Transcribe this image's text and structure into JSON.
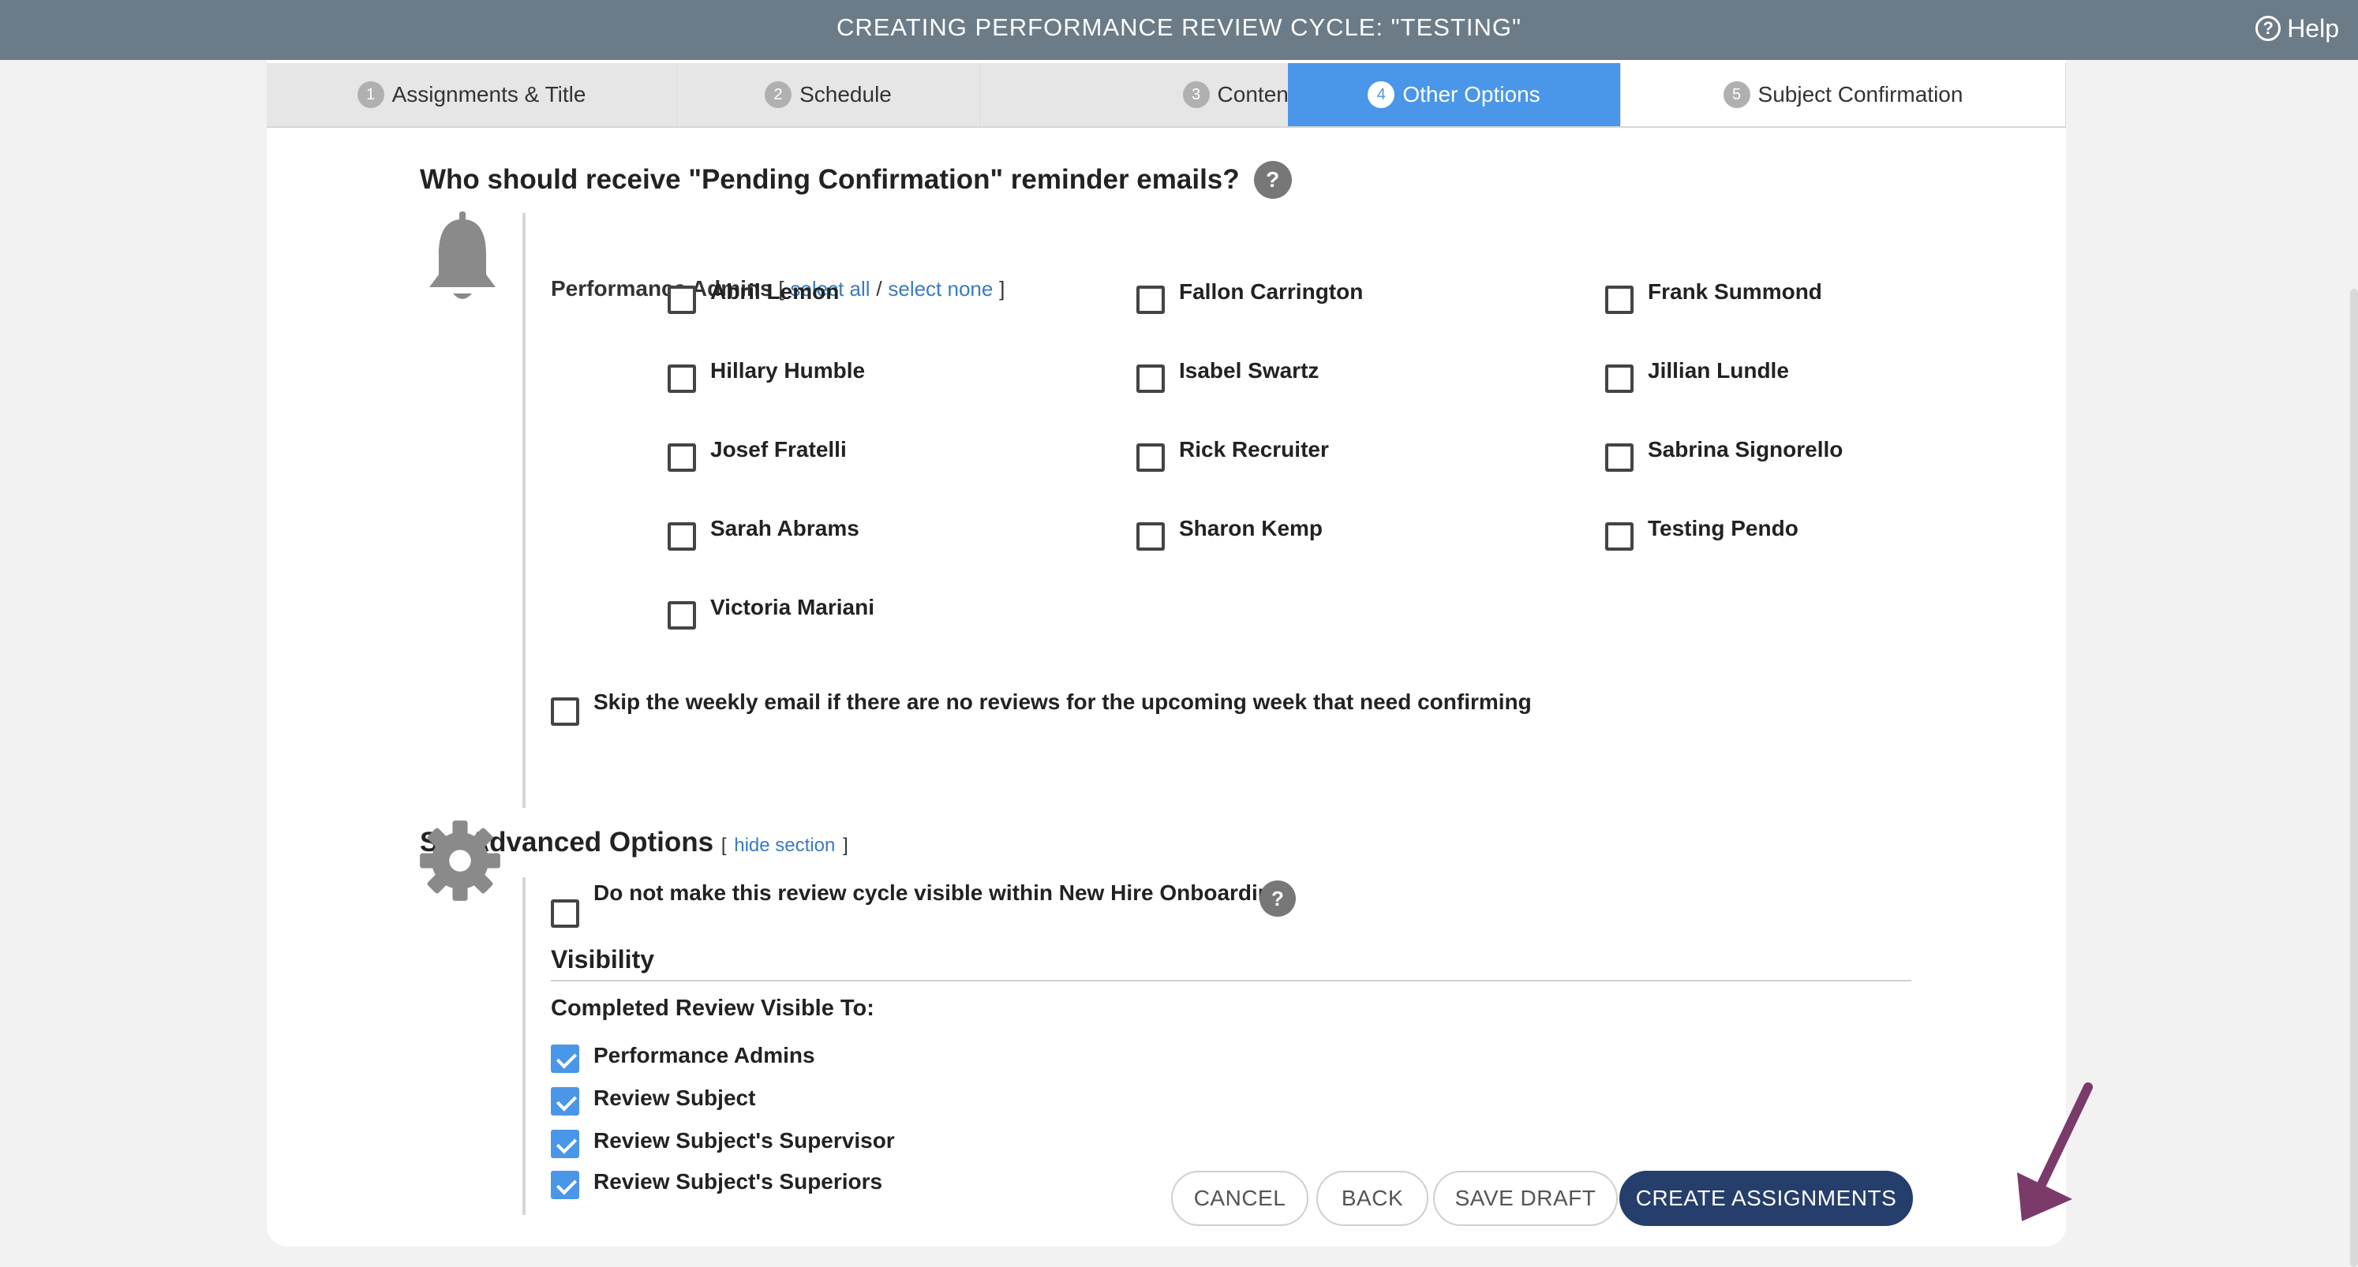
{
  "header": {
    "title": "CREATING PERFORMANCE REVIEW CYCLE: \"TESTING\"",
    "help_label": "Help",
    "help_glyph": "?"
  },
  "tabs": [
    {
      "num": "1",
      "label": "Assignments & Title"
    },
    {
      "num": "2",
      "label": "Schedule"
    },
    {
      "num": "3",
      "label": "Content & Structure"
    },
    {
      "num": "4",
      "label": "Other Options"
    },
    {
      "num": "5",
      "label": "Subject Confirmation"
    }
  ],
  "reminder": {
    "question": "Who should receive \"Pending Confirmation\" reminder emails?",
    "question_badge": "?",
    "group_label": "Performance Admins",
    "bracket_open": "[",
    "select_all": "select all",
    "separator": "/",
    "select_none": "select none",
    "bracket_close": "]",
    "admins": [
      "Abril Lemon",
      "Fallon Carrington",
      "Frank Summond",
      "Hillary Humble",
      "Isabel Swartz",
      "Jillian Lundle",
      "Josef Fratelli",
      "Rick Recruiter",
      "Sabrina Signorello",
      "Sarah Abrams",
      "Sharon Kemp",
      "Testing Pendo",
      "Victoria Mariani"
    ],
    "skip_weekly_label": "Skip the weekly email if there are no reviews for the upcoming week that need confirming"
  },
  "advanced": {
    "title": "Set Advanced Options",
    "bracket_open": "[",
    "hide_section": "hide section",
    "bracket_close": "]",
    "onboarding_label": "Do not make this review cycle visible within New Hire Onboarding.",
    "onboarding_badge": "?",
    "visibility_title": "Visibility",
    "completed_title": "Completed Review Visible To:",
    "visible_to": [
      {
        "label": "Performance Admins",
        "checked": true
      },
      {
        "label": "Review Subject",
        "checked": true
      },
      {
        "label": "Review Subject's Supervisor",
        "checked": true
      },
      {
        "label": "Review Subject's Superiors",
        "checked": true
      }
    ]
  },
  "buttons": {
    "cancel": "CANCEL",
    "back": "BACK",
    "save_draft": "SAVE DRAFT",
    "create": "CREATE ASSIGNMENTS"
  },
  "colors": {
    "header_bg": "#6b7b87",
    "active_tab": "#4a96e8",
    "primary_button": "#253e6b",
    "link": "#3a7bc0",
    "annotation_arrow": "#7a3a6a"
  }
}
